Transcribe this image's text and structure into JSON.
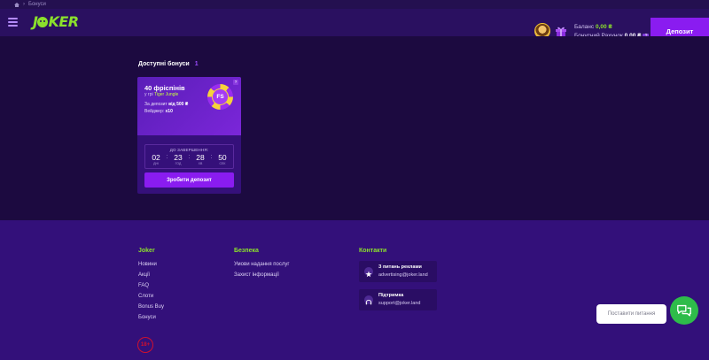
{
  "breadcrumb": {
    "current": "Бонуси"
  },
  "header": {
    "logo": "JOKER",
    "balance_label": "Баланс",
    "balance_value": "0,00 ₴",
    "bonus_label": "Бонусний Рахунок",
    "bonus_value": "0,00 ₴",
    "bonus_help": "?",
    "deposit_label": "Депозит"
  },
  "bonuses": {
    "title": "Доступні бонуси",
    "count": "1",
    "card": {
      "title": "40 фріспінів",
      "game_prefix": "у грі",
      "game_name": "Tiger Jungle",
      "deposit_prefix": "За депозит",
      "deposit_value": "від 500 ₴",
      "wager_prefix": "Вейджер:",
      "wager_value": "x10",
      "chip_label": "FS",
      "help": "?",
      "timer_label": "ДО ЗАВЕРШЕННЯ:",
      "timer": [
        {
          "value": "02",
          "unit": "ДНІ"
        },
        {
          "value": "23",
          "unit": "ГОД"
        },
        {
          "value": "28",
          "unit": "ХВ"
        },
        {
          "value": "50",
          "unit": "СЕК"
        }
      ],
      "button": "Зробити депозит"
    }
  },
  "footer": {
    "col1": {
      "title": "Joker",
      "links": [
        "Новини",
        "Акції",
        "FAQ",
        "Слоти",
        "Bonus Buy",
        "Бонуси"
      ]
    },
    "col2": {
      "title": "Безпека",
      "links": [
        "Умови надання послуг",
        "Захист інформації"
      ]
    },
    "col3": {
      "title": "Контакти",
      "contacts": [
        {
          "title": "З питань реклами",
          "email": "advertising@joker.land"
        },
        {
          "title": "Підтримка",
          "email": "support@joker.land"
        }
      ]
    },
    "age": "18+"
  },
  "chat": {
    "placeholder": "Поставити питання"
  },
  "colors": {
    "accent": "#8a1cf0",
    "brand_green": "#8be02c",
    "chat_green": "#2ebc4a"
  }
}
